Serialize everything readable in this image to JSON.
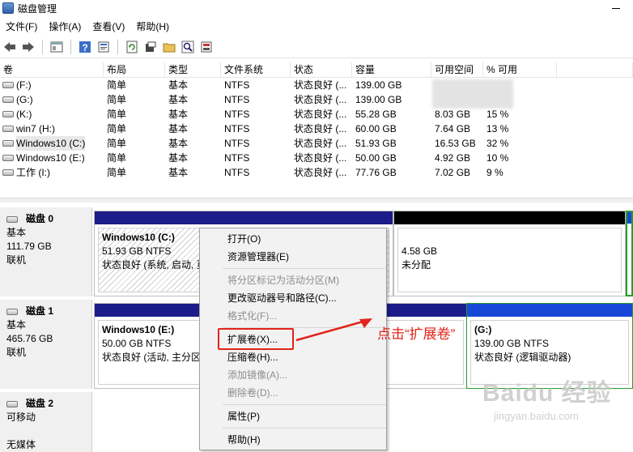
{
  "window": {
    "title": "磁盘管理"
  },
  "menu": [
    "文件(F)",
    "操作(A)",
    "查看(V)",
    "帮助(H)"
  ],
  "toolbar": {
    "buttons": [
      "back-icon",
      "forward-icon",
      "console-tree-icon",
      "help-icon",
      "properties-icon",
      "refresh-icon",
      "open-icon",
      "explore-icon",
      "rescan-icon"
    ]
  },
  "volumes": {
    "headers": [
      "卷",
      "布局",
      "类型",
      "文件系统",
      "状态",
      "容量",
      "可用空间",
      "% 可用"
    ],
    "rows": [
      {
        "name": "(F:)",
        "layout": "简单",
        "type": "基本",
        "fs": "NTFS",
        "status": "状态良好 (...",
        "capacity": "139.00 GB",
        "free": "",
        "pct": ""
      },
      {
        "name": "(G:)",
        "layout": "简单",
        "type": "基本",
        "fs": "NTFS",
        "status": "状态良好 (...",
        "capacity": "139.00 GB",
        "free": "",
        "pct": ""
      },
      {
        "name": "(K:)",
        "layout": "简单",
        "type": "基本",
        "fs": "NTFS",
        "status": "状态良好 (...",
        "capacity": "55.28 GB",
        "free": "8.03 GB",
        "pct": "15 %"
      },
      {
        "name": "win7 (H:)",
        "layout": "简单",
        "type": "基本",
        "fs": "NTFS",
        "status": "状态良好 (...",
        "capacity": "60.00 GB",
        "free": "7.64 GB",
        "pct": "13 %"
      },
      {
        "name": "Windows10 (C:)",
        "layout": "简单",
        "type": "基本",
        "fs": "NTFS",
        "status": "状态良好 (...",
        "capacity": "51.93 GB",
        "free": "16.53 GB",
        "pct": "32 %"
      },
      {
        "name": "Windows10 (E:)",
        "layout": "简单",
        "type": "基本",
        "fs": "NTFS",
        "status": "状态良好 (...",
        "capacity": "50.00 GB",
        "free": "4.92 GB",
        "pct": "10 %"
      },
      {
        "name": "工作 (I:)",
        "layout": "简单",
        "type": "基本",
        "fs": "NTFS",
        "status": "状态良好 (...",
        "capacity": "77.76 GB",
        "free": "7.02 GB",
        "pct": "9 %"
      }
    ]
  },
  "disks": [
    {
      "name": "磁盘 0",
      "kind": "基本",
      "size": "111.79 GB",
      "state": "联机"
    },
    {
      "name": "磁盘 1",
      "kind": "基本",
      "size": "465.76 GB",
      "state": "联机"
    },
    {
      "name": "磁盘 2",
      "kind": "可移动",
      "size": "",
      "state": "无媒体"
    }
  ],
  "partitions": {
    "c": {
      "name": "Windows10  (C:)",
      "size": "51.93 GB NTFS",
      "status": "状态良好 (系统, 启动, 页"
    },
    "unalloc": {
      "size": "4.58 GB",
      "status": "未分配"
    },
    "e": {
      "name": "Windows10  (E:)",
      "size": "50.00 GB NTFS",
      "status": "状态良好 (活动, 主分区"
    },
    "g": {
      "name": "(G:)",
      "size": "139.00 GB NTFS",
      "status": "状态良好 (逻辑驱动器)"
    }
  },
  "context_menu": {
    "items": [
      {
        "label": "打开(O)",
        "enabled": true
      },
      {
        "label": "资源管理器(E)",
        "enabled": true
      },
      {
        "label": "将分区标记为活动分区(M)",
        "enabled": false
      },
      {
        "label": "更改驱动器号和路径(C)...",
        "enabled": true
      },
      {
        "label": "格式化(F)...",
        "enabled": false
      },
      {
        "label": "扩展卷(X)...",
        "enabled": true
      },
      {
        "label": "压缩卷(H)...",
        "enabled": true
      },
      {
        "label": "添加镜像(A)...",
        "enabled": false
      },
      {
        "label": "删除卷(D)...",
        "enabled": false
      },
      {
        "label": "属性(P)",
        "enabled": true
      },
      {
        "label": "帮助(H)",
        "enabled": true
      }
    ]
  },
  "annotation": {
    "text": "点击“扩展卷”",
    "color": "#e2231a"
  },
  "watermark": {
    "main": "Baidu 经验",
    "sub": "jingyan.baidu.com"
  },
  "colors": {
    "primary_partition_bar": "#1c1c8a",
    "unallocated_bar": "#000000",
    "logical_bar": "#1747d6",
    "extended_border": "#2a9d2a"
  }
}
